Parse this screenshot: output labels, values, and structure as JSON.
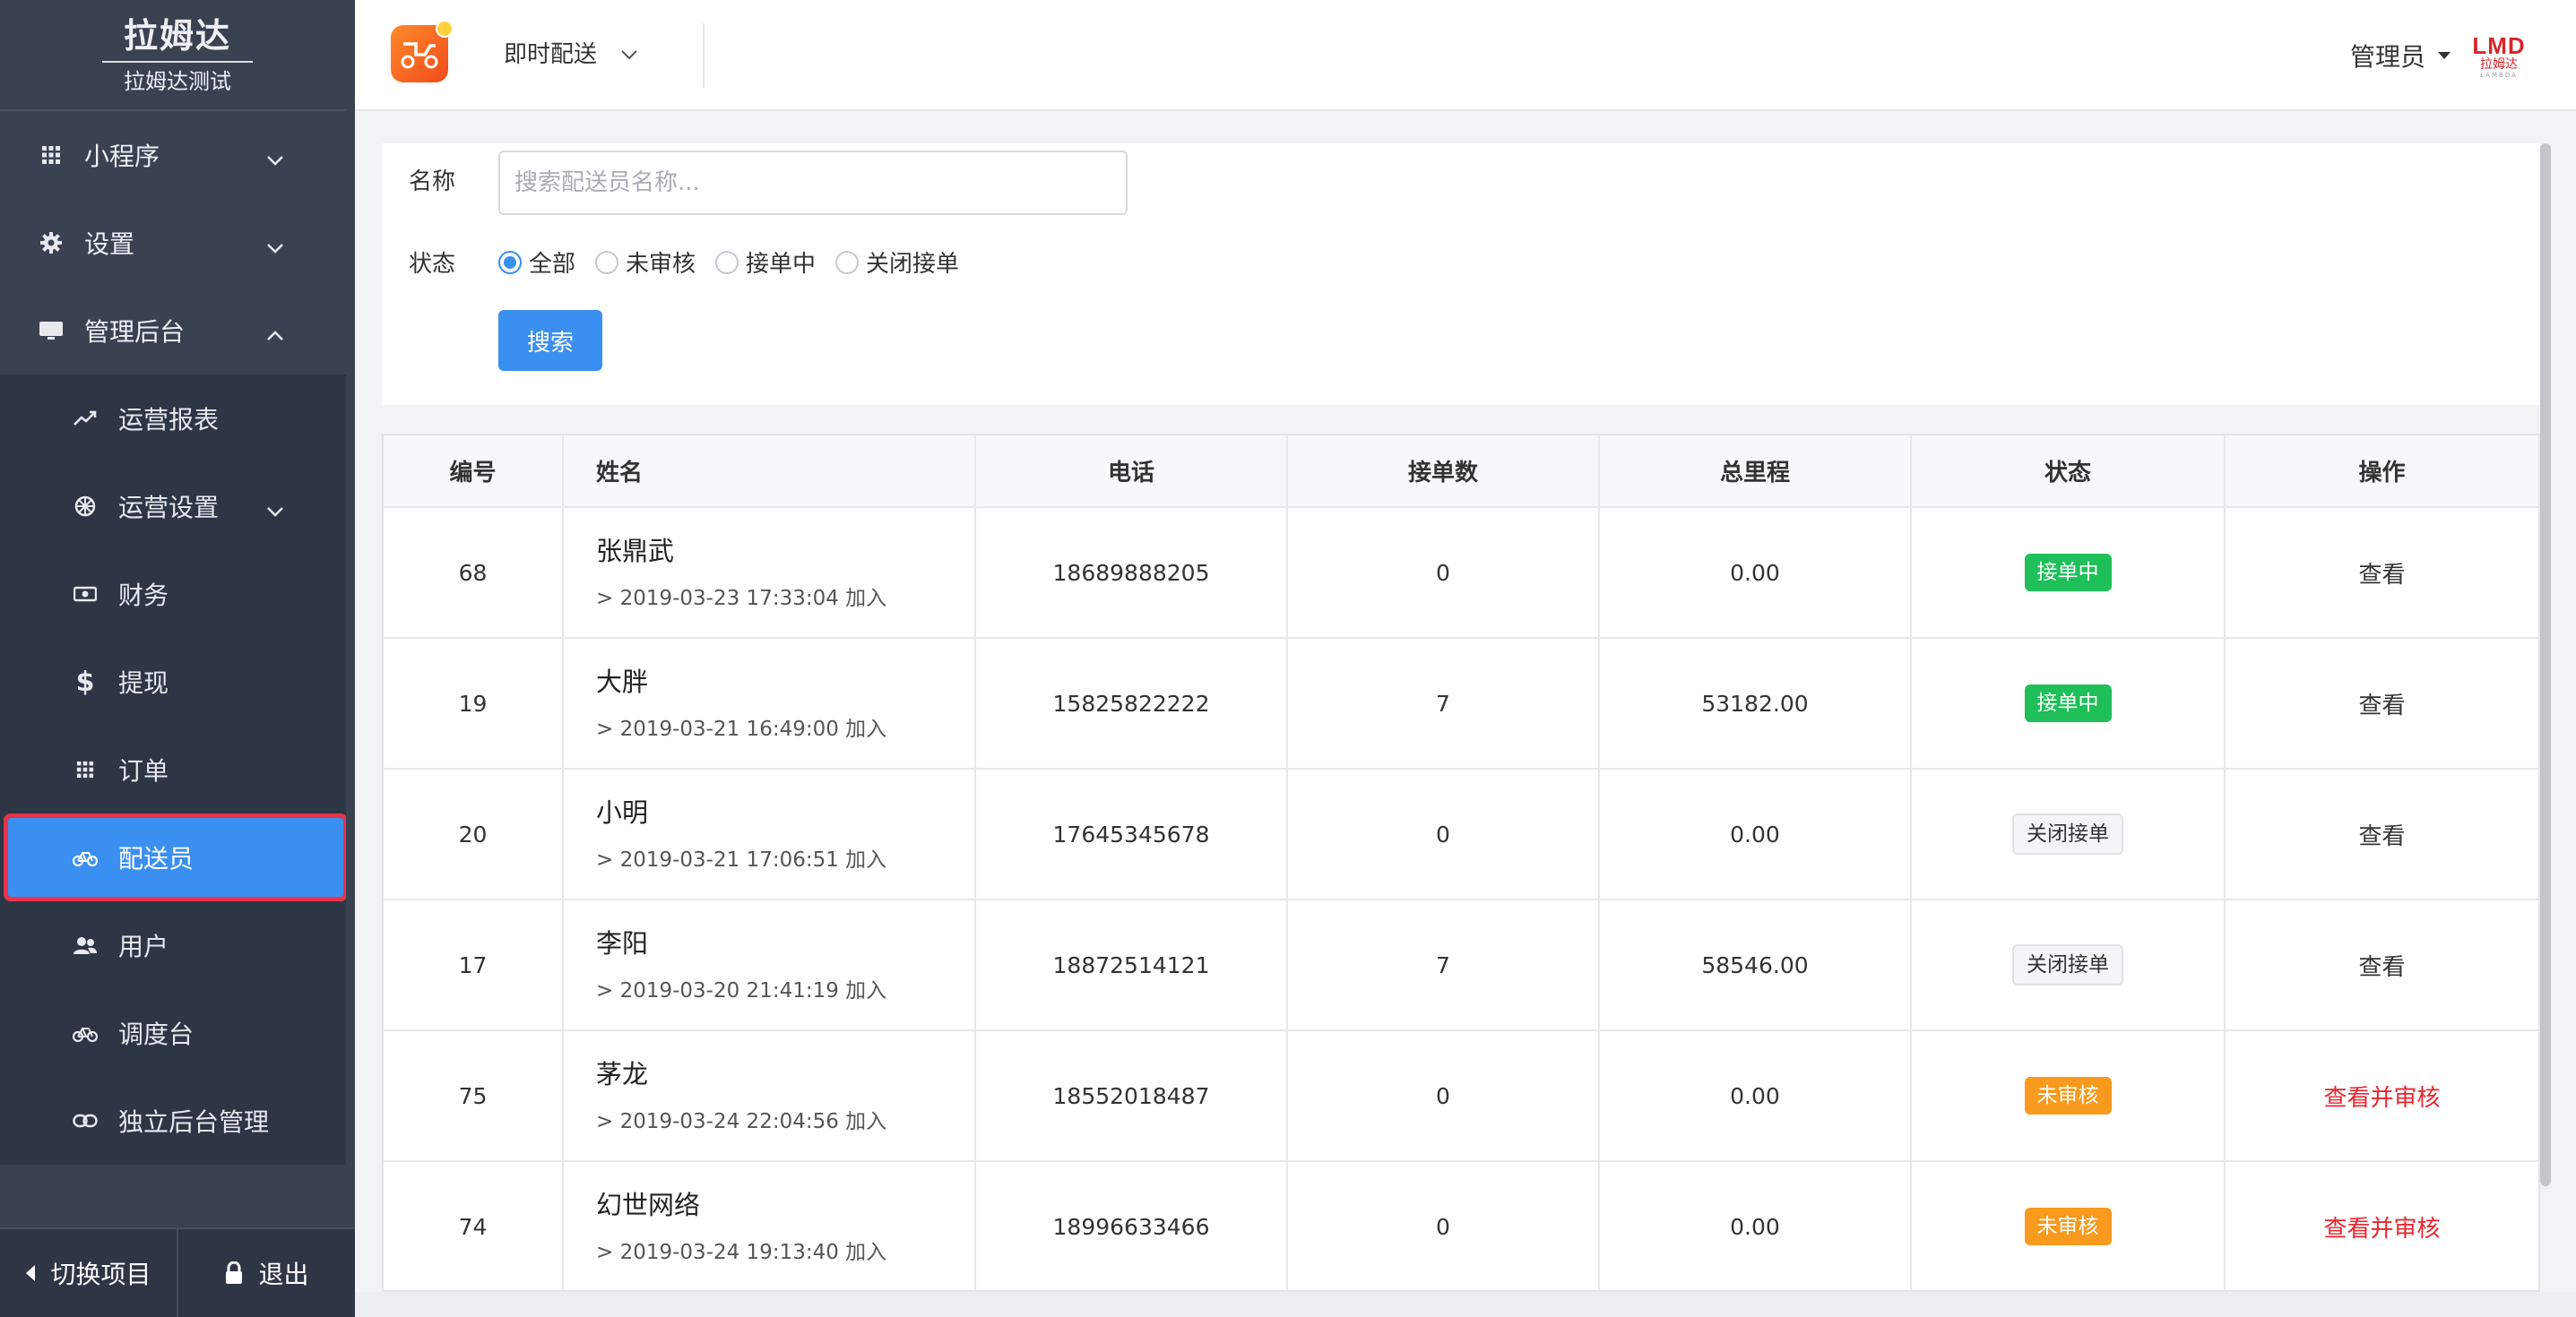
{
  "sidebar": {
    "brand_title": "拉姆达",
    "brand_subtitle": "拉姆达测试",
    "groups": [
      {
        "label": "小程序",
        "icon": "grid-icon"
      },
      {
        "label": "设置",
        "icon": "gear-icon"
      },
      {
        "label": "管理后台",
        "icon": "monitor-icon"
      }
    ],
    "items": [
      {
        "label": "运营报表",
        "icon": "trend-icon"
      },
      {
        "label": "运营设置",
        "icon": "cog-wheel-icon"
      },
      {
        "label": "财务",
        "icon": "money-icon"
      },
      {
        "label": "提现",
        "icon": "dollar-icon"
      },
      {
        "label": "订单",
        "icon": "grid-icon"
      },
      {
        "label": "配送员",
        "icon": "bicycle-icon",
        "active": true
      },
      {
        "label": "用户",
        "icon": "users-icon"
      },
      {
        "label": "调度台",
        "icon": "bicycle-icon"
      },
      {
        "label": "独立后台管理",
        "icon": "link-icon"
      }
    ],
    "footer": {
      "switch_label": "切换项目",
      "logout_label": "退出"
    }
  },
  "header": {
    "mode": "即时配送",
    "user": "管理员",
    "brand_mark": "LMD",
    "brand_mark_cn": "拉姆达",
    "brand_mark_en": "LAMBDA"
  },
  "filter": {
    "name_label": "名称",
    "name_placeholder": "搜索配送员名称...",
    "status_label": "状态",
    "status_options": [
      "全部",
      "未审核",
      "接单中",
      "关闭接单"
    ],
    "status_selected": "全部",
    "search_button": "搜索"
  },
  "table": {
    "columns": [
      "编号",
      "姓名",
      "电话",
      "接单数",
      "总里程",
      "状态",
      "操作"
    ],
    "rows": [
      {
        "id": "68",
        "name": "张鼎武",
        "joined": "> 2019-03-23 17:33:04 加入",
        "phone": "18689888205",
        "orders": "0",
        "mileage": "0.00",
        "status": "接单中",
        "status_color": "#1fbf5a",
        "action": "查看"
      },
      {
        "id": "19",
        "name": "大胖",
        "joined": "> 2019-03-21 16:49:00 加入",
        "phone": "15825822222",
        "orders": "7",
        "mileage": "53182.00",
        "status": "接单中",
        "status_color": "#1fbf5a",
        "action": "查看"
      },
      {
        "id": "20",
        "name": "小明",
        "joined": "> 2019-03-21 17:06:51 加入",
        "phone": "17645345678",
        "orders": "0",
        "mileage": "0.00",
        "status": "关闭接单",
        "status_color": "#f4f5f7",
        "action": "查看"
      },
      {
        "id": "17",
        "name": "李阳",
        "joined": "> 2019-03-20 21:41:19 加入",
        "phone": "18872514121",
        "orders": "7",
        "mileage": "58546.00",
        "status": "关闭接单",
        "status_color": "#f4f5f7",
        "action": "查看"
      },
      {
        "id": "75",
        "name": "茅龙",
        "joined": "> 2019-03-24 22:04:56 加入",
        "phone": "18552018487",
        "orders": "0",
        "mileage": "0.00",
        "status": "未审核",
        "status_color": "#f79a1d",
        "action": "查看并审核"
      },
      {
        "id": "74",
        "name": "幻世网络",
        "joined": "> 2019-03-24 19:13:40 加入",
        "phone": "18996633466",
        "orders": "0",
        "mileage": "0.00",
        "status": "未审核",
        "status_color": "#f79a1d",
        "action": "查看并审核"
      }
    ]
  },
  "colors": {
    "primary": "#3b8ff0",
    "sidebar_bg": "#3a4252",
    "danger": "#e8262e",
    "success": "#1fbf5a",
    "warning": "#f79a1d"
  }
}
